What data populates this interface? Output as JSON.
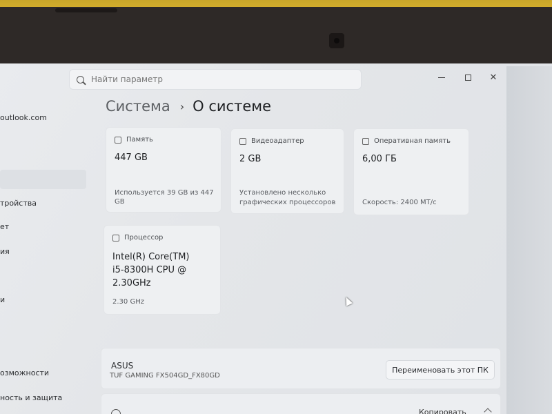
{
  "search": {
    "placeholder": "Найти параметр"
  },
  "sidebar": {
    "account_email_fragment": "outlook.com",
    "items": [
      {
        "label": "тройства"
      },
      {
        "label": "ет"
      },
      {
        "label": "ия"
      },
      {
        "label": "и"
      },
      {
        "label": "озможности"
      },
      {
        "label": "ность и защита"
      }
    ]
  },
  "breadcrumb": {
    "parent": "Система",
    "separator": "›",
    "current": "О системе"
  },
  "cards": {
    "storage": {
      "label": "Память",
      "value": "447 GB",
      "detail": "Используется 39 GB из 447 GB"
    },
    "gpu": {
      "label": "Видеоадаптер",
      "value": "2 GB",
      "detail_line1": "Установлено несколько",
      "detail_line2": "графических процессоров"
    },
    "ram": {
      "label": "Оперативная память",
      "value": "6,00 ГБ",
      "detail": "Скорость: 2400 МТ/с"
    },
    "cpu": {
      "label": "Процессор",
      "value_line1": "Intel(R) Core(TM)",
      "value_line2": "i5-8300H CPU @",
      "value_line3": "2.30GHz",
      "detail": "2.30 GHz"
    }
  },
  "device": {
    "brand": "ASUS",
    "model": "TUF GAMING FX504GD_FX80GD",
    "rename_label": "Переименовать этот ПК"
  },
  "bottom": {
    "copy_label": "Копировать"
  }
}
